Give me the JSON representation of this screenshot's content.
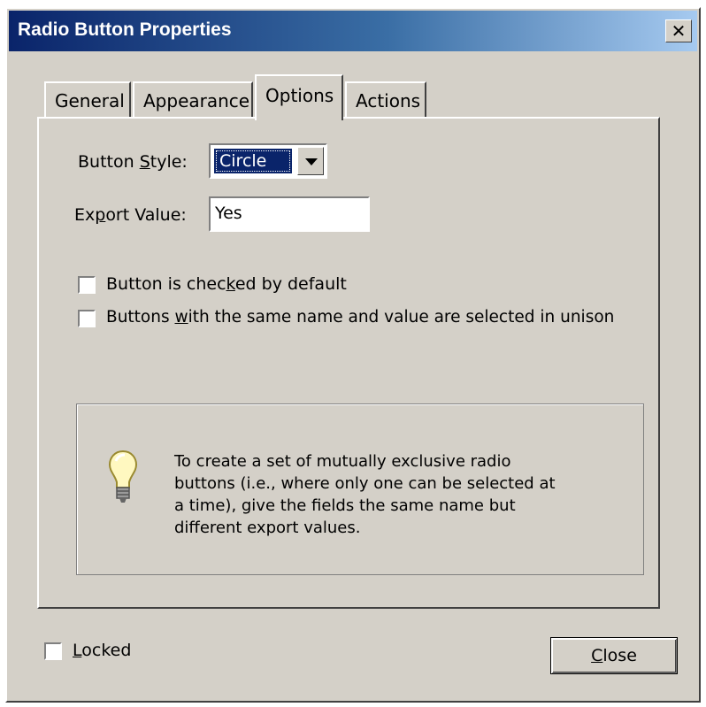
{
  "window": {
    "title": "Radio Button Properties",
    "close_glyph": "✕"
  },
  "tabs": [
    {
      "label": "General",
      "active": false
    },
    {
      "label": "Appearance",
      "active": false
    },
    {
      "label": "Options",
      "active": true
    },
    {
      "label": "Actions",
      "active": false
    }
  ],
  "options": {
    "button_style": {
      "label_pre": "Button ",
      "label_mnemonic": "S",
      "label_post": "tyle:",
      "value": "Circle"
    },
    "export_value": {
      "label_pre": "Ex",
      "label_mnemonic": "p",
      "label_post": "ort Value:",
      "value": "Yes"
    },
    "checked_by_default": {
      "label_pre": "Button is chec",
      "label_mnemonic": "k",
      "label_post": "ed by default",
      "checked": false
    },
    "select_in_unison": {
      "label_pre": "Buttons ",
      "label_mnemonic": "w",
      "label_post": "ith the same name and value are selected in unison",
      "checked": false
    },
    "info": {
      "icon": "lightbulb-icon",
      "line1": "To create a set of mutually exclusive radio",
      "line2": "buttons (i.e., where only one can be selected at",
      "line3": "a time), give the fields the same name but",
      "line4": "different export values."
    }
  },
  "footer": {
    "locked": {
      "label_mnemonic": "L",
      "label_post": "ocked",
      "checked": false
    },
    "close_button": {
      "label_mnemonic": "C",
      "label_post": "lose"
    }
  },
  "colors": {
    "face": "#d4d0c8",
    "title_start": "#0a246a",
    "title_end": "#a6caf0",
    "selection": "#0a246a"
  }
}
